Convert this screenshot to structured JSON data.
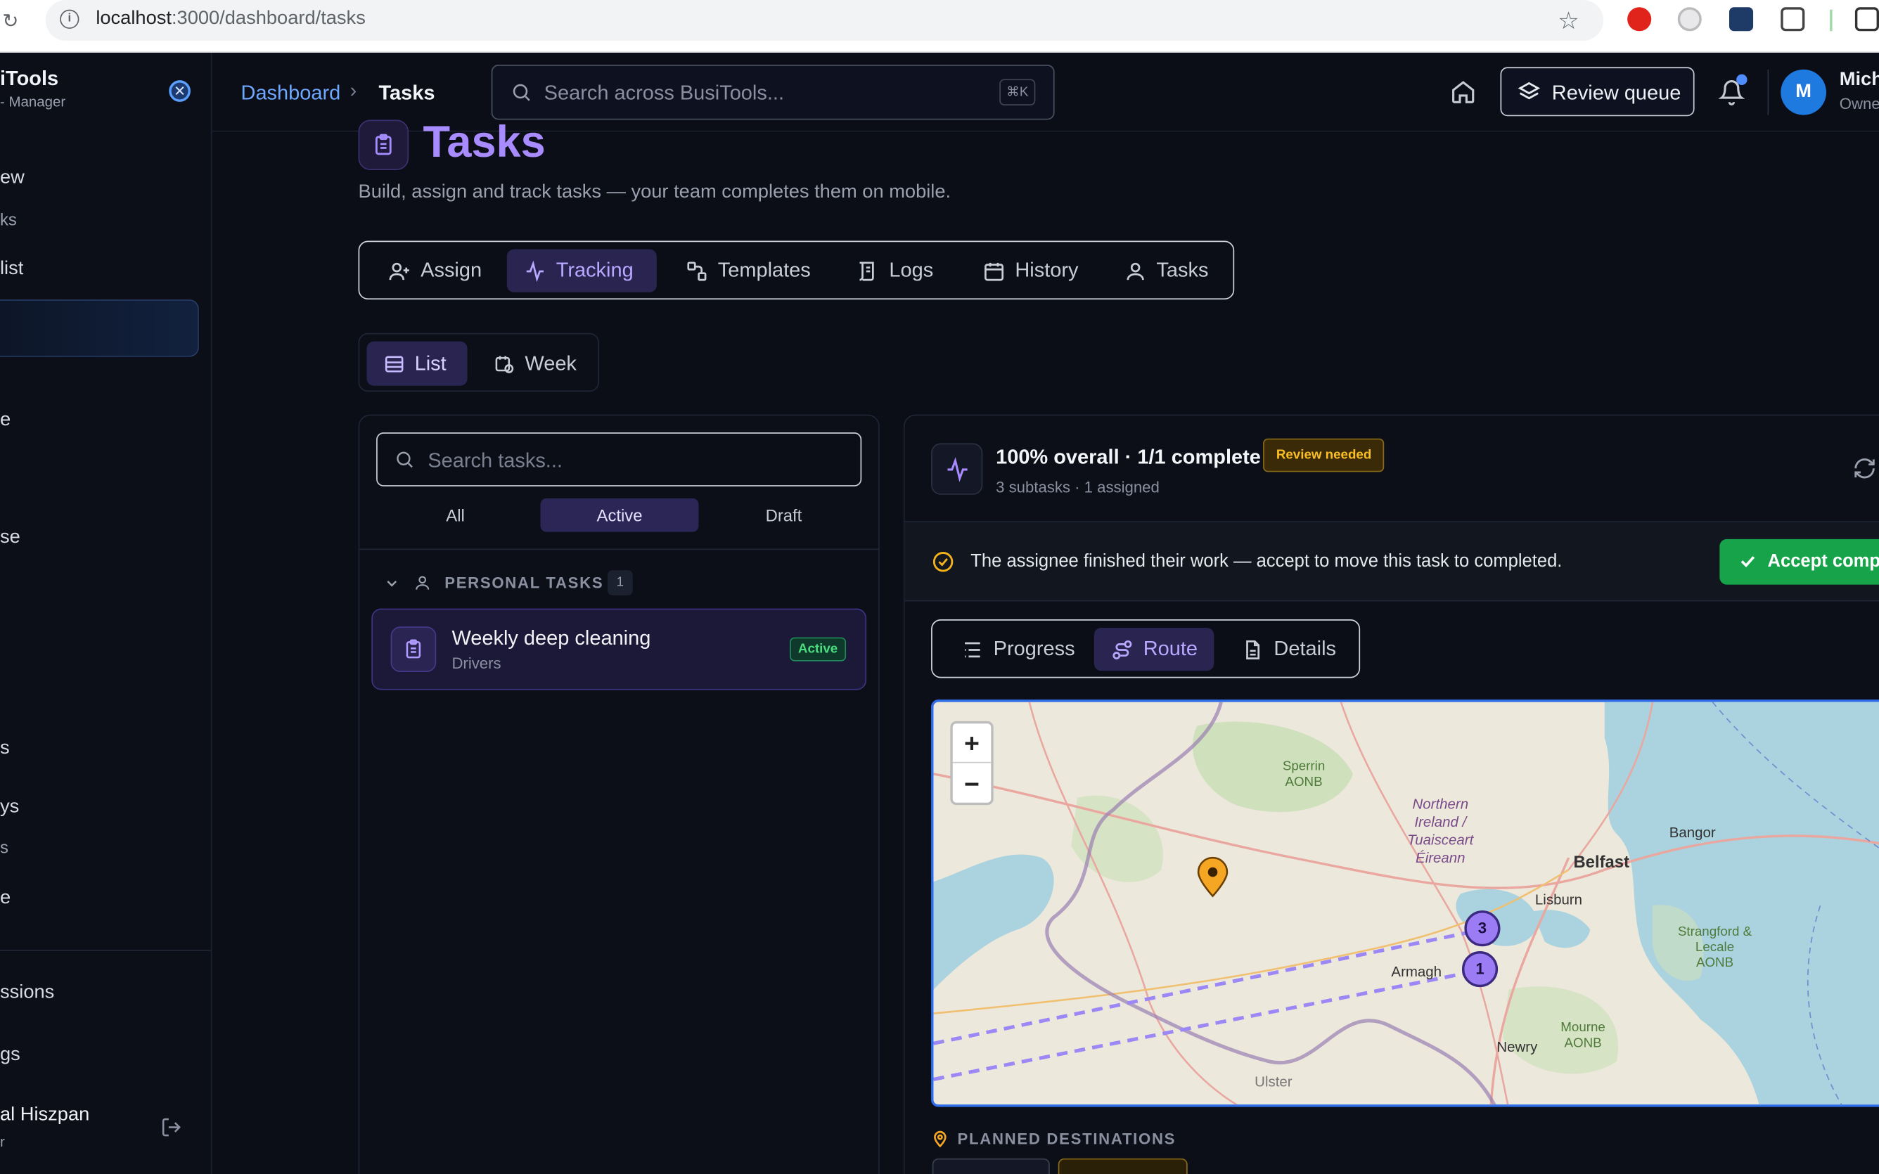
{
  "browser": {
    "url_host": "localhost",
    "url_path": ":3000/dashboard/tasks"
  },
  "sidebar": {
    "brand": "iTools",
    "brand_sub": "- Manager",
    "items": [
      "ew",
      "ks",
      "list",
      "e",
      "se",
      "s",
      "ys",
      "s",
      "e",
      "ssions",
      "gs"
    ],
    "user_name": "al Hiszpan",
    "user_role": "r"
  },
  "topbar": {
    "breadcrumb_root": "Dashboard",
    "breadcrumb_current": "Tasks",
    "search_placeholder": "Search across BusiTools...",
    "search_shortcut": "⌘K",
    "review_queue": "Review queue",
    "user_initial": "M",
    "user_name": "Mich",
    "user_role": "Owne"
  },
  "page": {
    "title": "Tasks",
    "subtitle": "Build, assign and track tasks — your team completes them on mobile.",
    "tabs": [
      "Assign",
      "Tracking",
      "Templates",
      "Logs",
      "History",
      "Tasks"
    ],
    "active_tab": "Tracking",
    "views": [
      "List",
      "Week"
    ]
  },
  "task_list": {
    "search_placeholder": "Search tasks...",
    "filters": [
      "All",
      "Active",
      "Draft"
    ],
    "group_label": "PERSONAL TASKS",
    "group_count": "1",
    "task_title": "Weekly deep cleaning",
    "task_sub": "Drivers",
    "task_status": "Active"
  },
  "detail": {
    "progress_title": "100% overall · 1/1 complete",
    "review_badge": "Review needed",
    "progress_sub": "3 subtasks · 1 assigned",
    "banner_text": "The assignee finished their work — accept to move this task to completed.",
    "accept_button": "Accept compl",
    "subtabs": [
      "Progress",
      "Route",
      "Details"
    ],
    "map_zoom_in": "+",
    "map_zoom_out": "−",
    "map_labels": [
      "Sperrin AONB",
      "Northern Ireland / Tuaisceart Éireann",
      "Belfast",
      "Bangor",
      "Lisburn",
      "Armagh",
      "Strangford & Lecale AONB",
      "Mourne AONB",
      "Newry",
      "Ulster"
    ],
    "marker_labels": [
      "3",
      "1"
    ],
    "planned_destinations": "PLANNED DESTINATIONS"
  },
  "colors": {
    "accent": "#8b6cf6",
    "success": "#16a34a",
    "warning": "#f59e0b",
    "link": "#6ea8ff"
  }
}
